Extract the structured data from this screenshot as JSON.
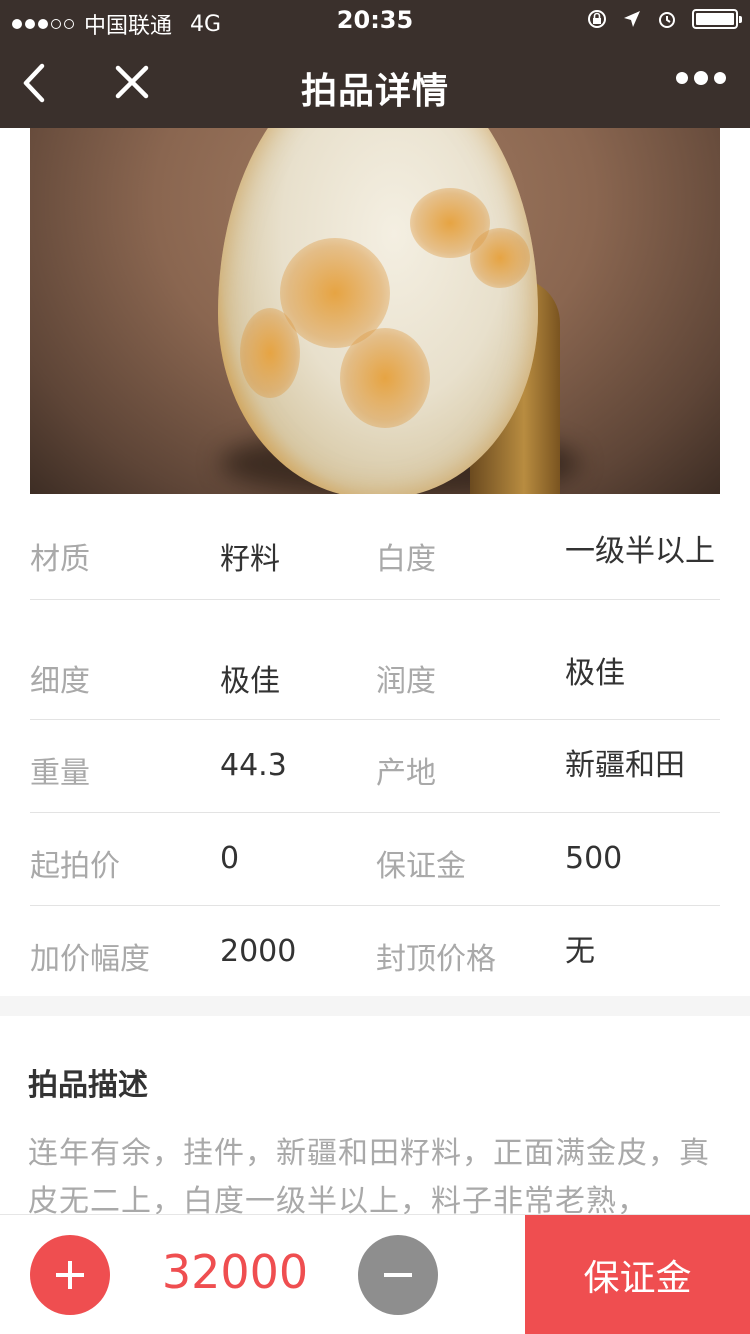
{
  "status_bar": {
    "carrier": "中国联通",
    "network": "4G",
    "time": "20:35"
  },
  "nav": {
    "title": "拍品详情",
    "icons": [
      "back-arrow-icon",
      "close-icon",
      "more-dots-icon"
    ]
  },
  "attributes": [
    {
      "label1": "材质",
      "value1": "籽料",
      "label2": "白度",
      "value2": "一级半以上"
    },
    {
      "label1": "细度",
      "value1": "极佳",
      "label2": "润度",
      "value2": "极佳"
    },
    {
      "label1": "重量",
      "value1": "44.3",
      "label2": "产地",
      "value2": "新疆和田"
    },
    {
      "label1": "起拍价",
      "value1": "0",
      "label2": "保证金",
      "value2": "500"
    },
    {
      "label1": "加价幅度",
      "value1": "2000",
      "label2": "封顶价格",
      "value2": "无"
    }
  ],
  "description": {
    "title": "拍品描述",
    "text": "连年有余，挂件，新疆和田籽料，正面满金皮，真皮无二上，白度一级半以上，料子非常老熟，"
  },
  "bottom_bar": {
    "price": "32000",
    "deposit_button": "保证金"
  },
  "colors": {
    "nav_bg": "#3a302c",
    "accent": "#ef4e50",
    "minus_button": "#8e8e8e",
    "label_gray": "#a9a9a9"
  }
}
